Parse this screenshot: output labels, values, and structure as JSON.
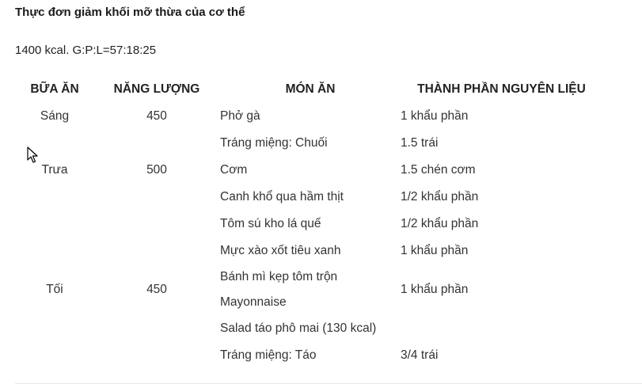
{
  "title": "Thực đơn giảm khối mỡ thừa của cơ thể",
  "summary": "1400 kcal. G:P:L=57:18:25",
  "table": {
    "headers": {
      "meal": "BỮA ĂN",
      "energy": "NĂNG LƯỢNG",
      "dish": "MÓN ĂN",
      "ingredient": "THÀNH PHẦN NGUYÊN LIỆU"
    },
    "rows": [
      {
        "meal": "Sáng",
        "energy": "450",
        "dish": "Phở gà",
        "ingredient": "1 khẩu phần"
      },
      {
        "meal": "",
        "energy": "",
        "dish": "Tráng miệng: Chuối",
        "ingredient": "1.5 trái"
      },
      {
        "meal": "Trưa",
        "energy": "500",
        "dish": "Cơm",
        "ingredient": "1.5 chén cơm"
      },
      {
        "meal": "",
        "energy": "",
        "dish": "Canh khổ qua hầm thịt",
        "ingredient": "1/2 khẩu phần"
      },
      {
        "meal": "",
        "energy": "",
        "dish": "Tôm sú kho lá quế",
        "ingredient": "1/2 khẩu phần"
      },
      {
        "meal": "",
        "energy": "",
        "dish": "Mực xào xốt tiêu xanh",
        "ingredient": "1 khẩu phần"
      },
      {
        "meal": "Tối",
        "energy": "450",
        "dish": "Bánh mì kẹp tôm trộn Mayonnaise",
        "ingredient": "1 khẩu phần"
      },
      {
        "meal": "",
        "energy": "",
        "dish": "Salad táo phô mai (130 kcal)",
        "ingredient": ""
      },
      {
        "meal": "",
        "energy": "",
        "dish": "Tráng miệng: Táo",
        "ingredient": "3/4 trái"
      }
    ]
  },
  "cursor_icon": "arrow-cursor-icon"
}
